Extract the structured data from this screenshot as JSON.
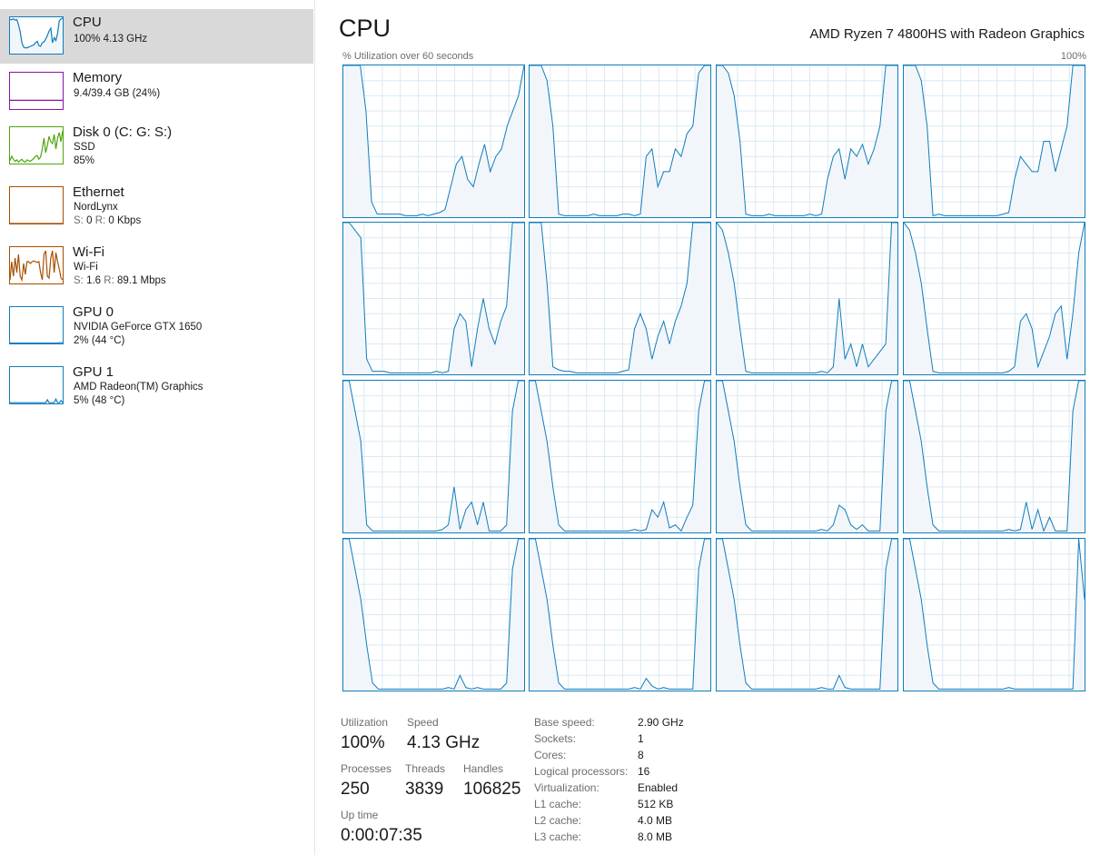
{
  "sidebar": {
    "items": [
      {
        "title": "CPU",
        "line1": "100%  4.13 GHz",
        "line2": "",
        "line3": "",
        "color": "#117dbb",
        "fill": "#f1f6fa",
        "selected": true,
        "series": [
          95,
          93,
          96,
          92,
          94,
          80,
          60,
          30,
          18,
          16,
          16,
          18,
          20,
          22,
          24,
          30,
          34,
          22,
          20,
          30,
          32,
          40,
          50,
          62,
          70,
          30,
          44,
          36,
          56,
          90,
          95,
          98
        ]
      },
      {
        "title": "Memory",
        "line1": "9.4/39.4 GB (24%)",
        "line2": "",
        "line3": "",
        "color": "#8b12ae",
        "fill": "#ffffff",
        "selected": false,
        "series": [
          24,
          24,
          24,
          24,
          24,
          24,
          24,
          24,
          24,
          24,
          24,
          24,
          24,
          24,
          24,
          24,
          24,
          24,
          24,
          24,
          24,
          24,
          24,
          24,
          24,
          24,
          24,
          24,
          24,
          24,
          24,
          24
        ]
      },
      {
        "title": "Disk 0 (C: G: S:)",
        "line1": "SSD",
        "line2": "85%",
        "line3": "",
        "color": "#4da60c",
        "fill": "#ffffff",
        "selected": false,
        "series": [
          8,
          20,
          12,
          6,
          10,
          4,
          8,
          12,
          6,
          4,
          10,
          8,
          6,
          10,
          14,
          20,
          22,
          12,
          18,
          40,
          70,
          30,
          50,
          75,
          60,
          55,
          80,
          40,
          70,
          85,
          60,
          90
        ]
      },
      {
        "title": "Ethernet",
        "line1": "NordLynx",
        "line2": "",
        "line3": "",
        "label_s": "S:",
        "val_s": "0",
        "label_r": "R:",
        "val_r": "0 Kbps",
        "color": "#a74f01",
        "fill": "#ffffff",
        "selected": false,
        "series": [
          0,
          0,
          0,
          0,
          0,
          0,
          0,
          0,
          0,
          0,
          0,
          0,
          0,
          0,
          0,
          0,
          0,
          0,
          0,
          0,
          0,
          0,
          0,
          0,
          0,
          0,
          0,
          0,
          0,
          0,
          0,
          0
        ]
      },
      {
        "title": "Wi-Fi",
        "line1": "Wi-Fi",
        "line2": "",
        "line3": "",
        "label_s": "S:",
        "val_s": "1.6",
        "label_r": "R:",
        "val_r": "89.1 Mbps",
        "color": "#a74f01",
        "fill": "#ffffff",
        "selected": false,
        "series": [
          10,
          60,
          20,
          70,
          30,
          80,
          20,
          10,
          55,
          25,
          60,
          60,
          55,
          60,
          62,
          60,
          58,
          60,
          30,
          10,
          80,
          90,
          20,
          15,
          70,
          90,
          30,
          85,
          60,
          40,
          15,
          10
        ]
      },
      {
        "title": "GPU 0",
        "line1": "NVIDIA GeForce GTX 1650",
        "line2": "2%  (44 °C)",
        "line3": "",
        "color": "#117dbb",
        "fill": "#ffffff",
        "selected": false,
        "series": [
          1,
          1,
          1,
          1,
          1,
          1,
          1,
          1,
          1,
          1,
          1,
          1,
          1,
          1,
          1,
          1,
          1,
          1,
          1,
          1,
          1,
          1,
          1,
          1,
          1,
          1,
          1,
          1,
          1,
          2,
          2,
          2
        ]
      },
      {
        "title": "GPU 1",
        "line1": "AMD Radeon(TM) Graphics",
        "line2": "5%  (48 °C)",
        "line3": "",
        "color": "#117dbb",
        "fill": "#ffffff",
        "selected": false,
        "series": [
          2,
          2,
          2,
          2,
          2,
          2,
          2,
          2,
          2,
          2,
          2,
          2,
          2,
          2,
          2,
          2,
          2,
          2,
          2,
          2,
          2,
          2,
          10,
          2,
          2,
          2,
          2,
          12,
          2,
          2,
          8,
          2
        ]
      }
    ]
  },
  "main": {
    "title": "CPU",
    "subtitle": "AMD Ryzen 7 4800HS with Radeon Graphics",
    "util_label": "% Utilization over 60 seconds",
    "util_max": "100%",
    "line_color": "#117dbb",
    "fill_color": "#f1f6fa",
    "grid_color": "#d9eaf4",
    "cores": [
      [
        100,
        100,
        100,
        100,
        70,
        10,
        2,
        2,
        2,
        2,
        2,
        1,
        1,
        1,
        2,
        1,
        2,
        3,
        5,
        20,
        35,
        40,
        25,
        20,
        35,
        48,
        30,
        40,
        45,
        60,
        70,
        80,
        100
      ],
      [
        100,
        100,
        100,
        90,
        60,
        2,
        1,
        1,
        1,
        1,
        1,
        2,
        1,
        1,
        1,
        1,
        2,
        2,
        1,
        2,
        40,
        45,
        20,
        30,
        30,
        45,
        40,
        55,
        60,
        95,
        100,
        100
      ],
      [
        100,
        100,
        95,
        80,
        50,
        2,
        1,
        1,
        1,
        2,
        1,
        1,
        1,
        1,
        1,
        1,
        2,
        1,
        2,
        25,
        40,
        45,
        25,
        45,
        40,
        48,
        35,
        45,
        60,
        100,
        100,
        100
      ],
      [
        100,
        100,
        100,
        90,
        60,
        1,
        2,
        1,
        1,
        1,
        1,
        1,
        1,
        1,
        1,
        1,
        1,
        2,
        3,
        25,
        40,
        35,
        30,
        30,
        50,
        50,
        30,
        45,
        60,
        100,
        100,
        100
      ],
      [
        100,
        100,
        95,
        90,
        10,
        2,
        2,
        2,
        1,
        1,
        1,
        1,
        1,
        1,
        1,
        1,
        2,
        1,
        2,
        30,
        40,
        35,
        5,
        30,
        50,
        30,
        20,
        35,
        45,
        100,
        100,
        100
      ],
      [
        100,
        100,
        100,
        60,
        5,
        3,
        2,
        2,
        1,
        1,
        1,
        1,
        1,
        1,
        1,
        1,
        2,
        3,
        30,
        40,
        30,
        10,
        25,
        35,
        20,
        35,
        45,
        60,
        100,
        100,
        100,
        100
      ],
      [
        100,
        95,
        80,
        60,
        30,
        2,
        1,
        1,
        1,
        1,
        1,
        1,
        1,
        1,
        1,
        1,
        1,
        1,
        2,
        1,
        5,
        50,
        10,
        20,
        5,
        20,
        5,
        10,
        15,
        20,
        100,
        100
      ],
      [
        100,
        95,
        80,
        60,
        30,
        2,
        1,
        1,
        1,
        1,
        1,
        1,
        1,
        1,
        1,
        1,
        1,
        1,
        2,
        5,
        35,
        40,
        30,
        5,
        15,
        25,
        40,
        45,
        10,
        40,
        80,
        100
      ],
      [
        100,
        100,
        80,
        60,
        5,
        1,
        1,
        1,
        1,
        1,
        1,
        1,
        1,
        1,
        1,
        1,
        1,
        2,
        5,
        30,
        2,
        15,
        20,
        5,
        20,
        1,
        1,
        1,
        5,
        80,
        100,
        100
      ],
      [
        100,
        100,
        80,
        60,
        30,
        5,
        1,
        1,
        1,
        1,
        1,
        1,
        1,
        1,
        1,
        1,
        1,
        1,
        2,
        1,
        2,
        15,
        10,
        20,
        3,
        5,
        1,
        10,
        18,
        80,
        100,
        100
      ],
      [
        100,
        100,
        80,
        60,
        30,
        5,
        1,
        1,
        1,
        1,
        1,
        1,
        1,
        1,
        1,
        1,
        1,
        1,
        2,
        1,
        5,
        18,
        15,
        5,
        2,
        5,
        1,
        1,
        1,
        80,
        100,
        100
      ],
      [
        100,
        100,
        80,
        60,
        30,
        5,
        1,
        1,
        1,
        1,
        1,
        1,
        1,
        1,
        1,
        1,
        1,
        1,
        2,
        1,
        2,
        20,
        2,
        15,
        1,
        10,
        1,
        1,
        1,
        80,
        100,
        100
      ],
      [
        100,
        100,
        80,
        60,
        30,
        5,
        1,
        1,
        1,
        1,
        1,
        1,
        1,
        1,
        1,
        1,
        1,
        1,
        2,
        1,
        10,
        2,
        1,
        2,
        1,
        1,
        1,
        1,
        5,
        80,
        100,
        100
      ],
      [
        100,
        100,
        80,
        60,
        30,
        5,
        1,
        1,
        1,
        1,
        1,
        1,
        1,
        1,
        1,
        1,
        1,
        1,
        2,
        1,
        8,
        3,
        1,
        2,
        1,
        1,
        1,
        1,
        1,
        80,
        100,
        100
      ],
      [
        100,
        100,
        80,
        60,
        30,
        5,
        1,
        1,
        1,
        1,
        1,
        1,
        1,
        1,
        1,
        1,
        1,
        1,
        2,
        1,
        1,
        10,
        2,
        1,
        1,
        1,
        1,
        1,
        1,
        80,
        100,
        100
      ],
      [
        100,
        100,
        80,
        60,
        30,
        5,
        1,
        1,
        1,
        1,
        1,
        1,
        1,
        1,
        1,
        1,
        1,
        1,
        2,
        1,
        1,
        1,
        1,
        1,
        1,
        1,
        1,
        1,
        1,
        1,
        100,
        60
      ]
    ]
  },
  "stats": {
    "utilization_label": "Utilization",
    "utilization_value": "100%",
    "speed_label": "Speed",
    "speed_value": "4.13 GHz",
    "processes_label": "Processes",
    "processes_value": "250",
    "threads_label": "Threads",
    "threads_value": "3839",
    "handles_label": "Handles",
    "handles_value": "106825",
    "uptime_label": "Up time",
    "uptime_value": "0:00:07:35",
    "details": [
      {
        "key": "Base speed:",
        "value": "2.90 GHz"
      },
      {
        "key": "Sockets:",
        "value": "1"
      },
      {
        "key": "Cores:",
        "value": "8"
      },
      {
        "key": "Logical processors:",
        "value": "16"
      },
      {
        "key": "Virtualization:",
        "value": "Enabled"
      },
      {
        "key": "L1 cache:",
        "value": "512 KB"
      },
      {
        "key": "L2 cache:",
        "value": "4.0 MB"
      },
      {
        "key": "L3 cache:",
        "value": "8.0 MB"
      }
    ]
  }
}
